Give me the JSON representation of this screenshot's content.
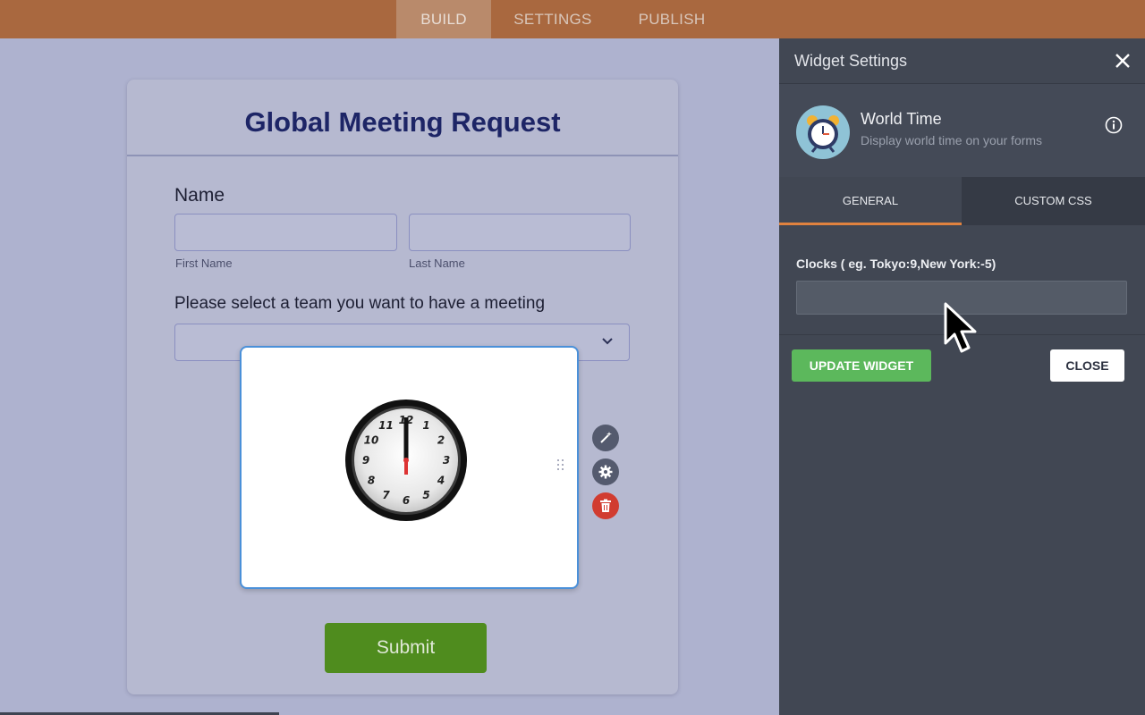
{
  "topnav": {
    "tabs": [
      {
        "label": "BUILD"
      },
      {
        "label": "SETTINGS"
      },
      {
        "label": "PUBLISH"
      }
    ],
    "active": "BUILD"
  },
  "form": {
    "title": "Global Meeting  Request",
    "name_label": "Name",
    "first_name_sublabel": "First Name",
    "last_name_sublabel": "Last Name",
    "team_label": "Please select a team you want to have a meeting",
    "submit_label": "Submit",
    "clock_numbers": [
      "12",
      "1",
      "2",
      "3",
      "4",
      "5",
      "6",
      "7",
      "8",
      "9",
      "10",
      "11"
    ]
  },
  "panel": {
    "title": "Widget Settings",
    "widget_name": "World Time",
    "widget_desc": "Display world time on your forms",
    "tabs": [
      {
        "label": "GENERAL"
      },
      {
        "label": "CUSTOM CSS"
      }
    ],
    "active_tab": "GENERAL",
    "clocks_label": "Clocks ( eg. Tokyo:9,New York:-5)",
    "clocks_value": "",
    "update_button": "UPDATE WIDGET",
    "close_button": "CLOSE"
  },
  "colors": {
    "topnav_bg": "#a9683f",
    "panel_bg": "#414753",
    "accent_orange": "#e0823f",
    "update_green": "#5cb85c",
    "submit_green": "#4f8c1e",
    "title_navy": "#1d2566",
    "delete_red": "#d13c30"
  },
  "icons": [
    "magic-wand-icon",
    "gear-icon",
    "trash-icon",
    "close-icon",
    "info-icon",
    "chevron-down-icon",
    "alarm-clock-icon",
    "drag-handle-icon",
    "mouse-cursor-icon"
  ]
}
